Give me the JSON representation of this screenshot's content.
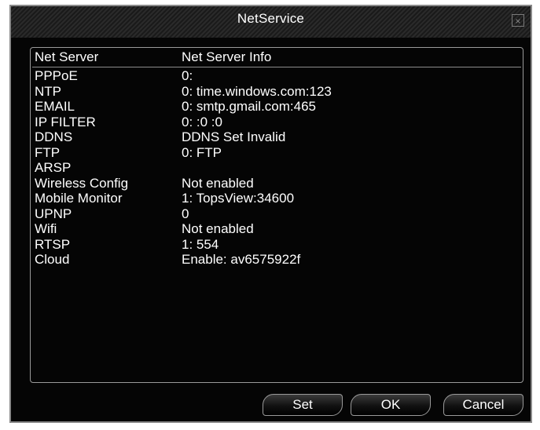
{
  "window": {
    "title": "NetService",
    "close_glyph": "×"
  },
  "table": {
    "headers": [
      "Net Server",
      "Net Server Info"
    ],
    "rows": [
      {
        "name": "PPPoE",
        "info": "0:"
      },
      {
        "name": "NTP",
        "info": "0: time.windows.com:123"
      },
      {
        "name": "EMAIL",
        "info": "0: smtp.gmail.com:465"
      },
      {
        "name": "IP FILTER",
        "info": "0: :0 :0"
      },
      {
        "name": "DDNS",
        "info": "DDNS Set Invalid"
      },
      {
        "name": "FTP",
        "info": "0: FTP"
      },
      {
        "name": "ARSP",
        "info": ""
      },
      {
        "name": "Wireless Config",
        "info": "Not enabled"
      },
      {
        "name": "Mobile Monitor",
        "info": "1: TopsView:34600"
      },
      {
        "name": "UPNP",
        "info": "0"
      },
      {
        "name": "Wifi",
        "info": "Not enabled"
      },
      {
        "name": "RTSP",
        "info": "1: 554"
      },
      {
        "name": "Cloud",
        "info": "Enable: av6575922f"
      }
    ]
  },
  "buttons": {
    "set_label": "Set",
    "ok_label": "OK",
    "cancel_label": "Cancel"
  },
  "colors": {
    "background": "#050505",
    "text": "#ffffff",
    "border": "#9a9a9a"
  },
  "icons": {
    "close": "close-icon"
  }
}
